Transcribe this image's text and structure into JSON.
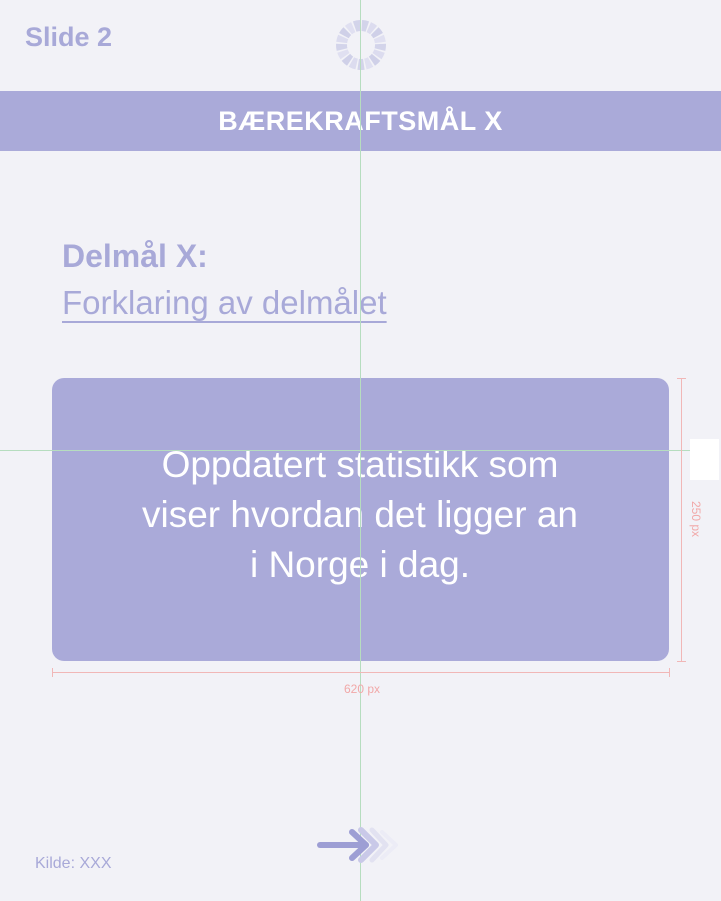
{
  "slide": {
    "label": "Slide 2"
  },
  "header": {
    "title": "BÆREKRAFTSMÅL X"
  },
  "subgoal": {
    "title": "Delmål X:",
    "description": "Forklaring av delmålet"
  },
  "stat_box": {
    "lines": [
      "Oppdatert statistikk som",
      "viser hvordan det ligger an",
      "i Norge i dag."
    ]
  },
  "dimensions": {
    "width_label": "620 px",
    "height_label": "250 px"
  },
  "footer": {
    "source": "Kilde: XXX"
  },
  "icons": {
    "logo": "sdg-wheel-icon",
    "next": "arrow-right-icon"
  },
  "colors": {
    "background": "#f2f2f7",
    "accent": "#aaaad9",
    "text_accent": "#a8a9d8",
    "guide": "#b6ddbf",
    "dimension": "#f1b7b7"
  }
}
